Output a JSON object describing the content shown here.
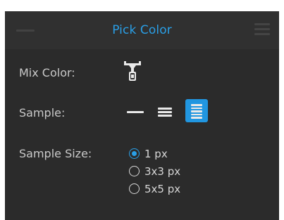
{
  "panel": {
    "title": "Pick Color",
    "accent_color": "#2a9fe6",
    "background_color": "#2b2b2b"
  },
  "icons": {
    "collapse": "collapse-icon",
    "menu": "hamburger-menu-icon",
    "mix": "mix-color-dropper-icon"
  },
  "mix_color": {
    "label": "Mix Color:"
  },
  "sample": {
    "label": "Sample:",
    "options": [
      {
        "name": "single-line",
        "selected": false
      },
      {
        "name": "triple-line",
        "selected": false
      },
      {
        "name": "multi-line",
        "selected": true
      }
    ]
  },
  "sample_size": {
    "label": "Sample Size:",
    "options": [
      {
        "label": "1 px",
        "selected": true
      },
      {
        "label": "3x3 px",
        "selected": false
      },
      {
        "label": "5x5 px",
        "selected": false
      }
    ]
  }
}
